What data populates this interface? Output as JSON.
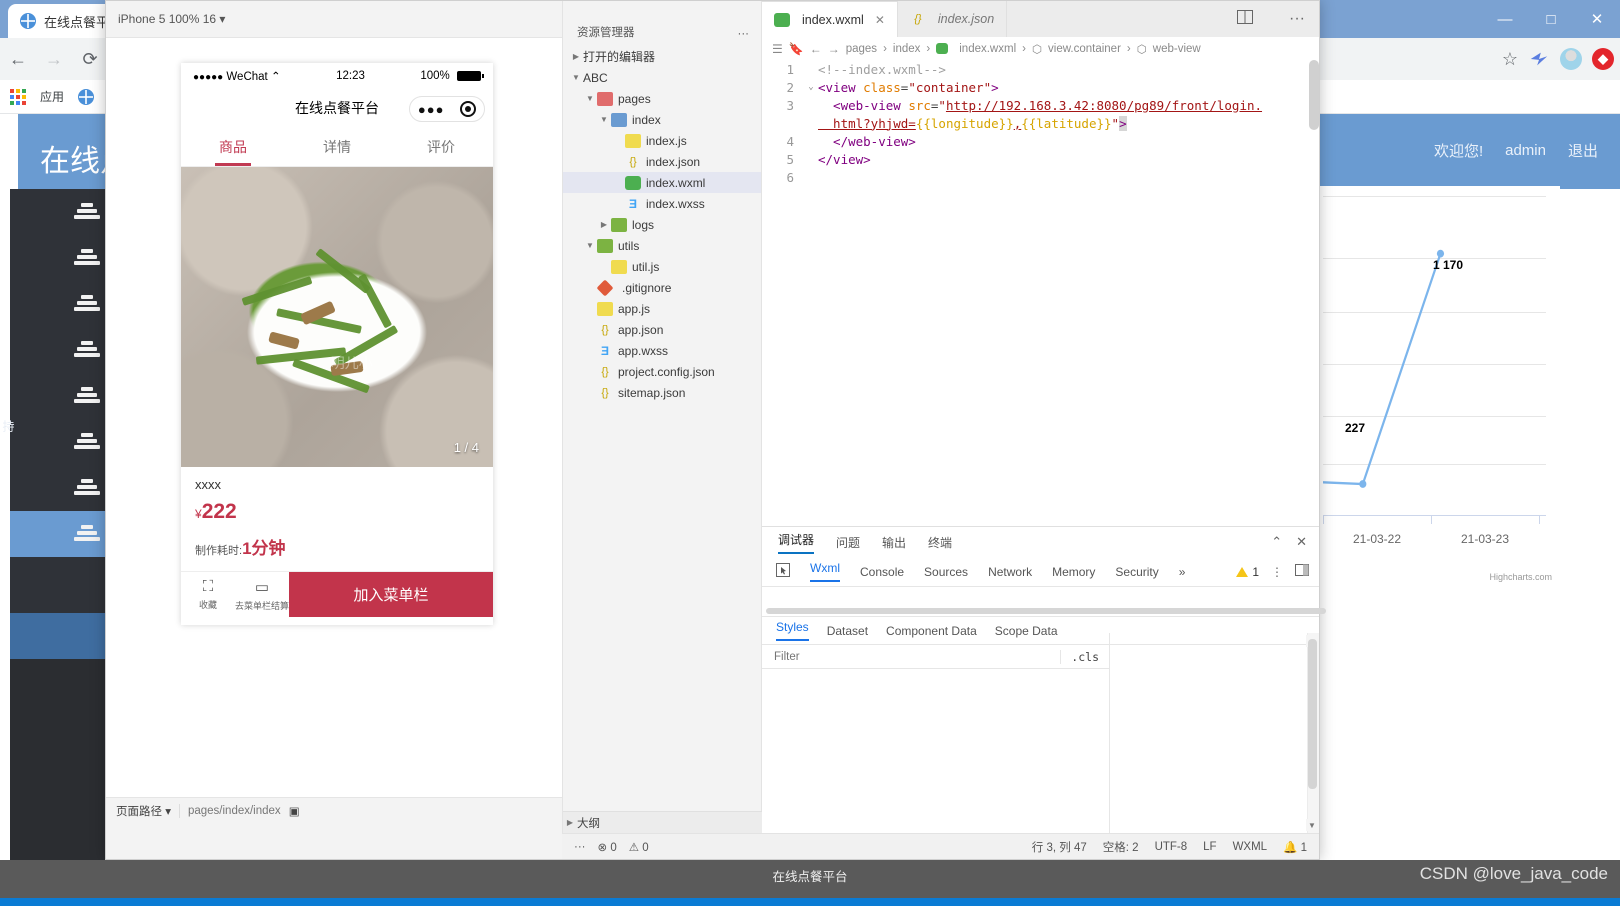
{
  "browser": {
    "tab_title": "在线点餐平",
    "window_controls": {
      "minimize": "—",
      "maximize": "□",
      "close": "✕"
    },
    "nav": {
      "back": "←",
      "forward": "→",
      "reload": "⟳"
    },
    "bookmarks": {
      "apps_label": "应用"
    },
    "right_icons": [
      "star-icon",
      "extension-icon",
      "avatar-icon",
      "opera-icon"
    ]
  },
  "app": {
    "title": "在线点餐平台",
    "welcome": "欢迎您!",
    "user": "admin",
    "logout": "退出",
    "sidebar_item_count": 8,
    "side_label": "持",
    "accent": "#6a9bd1"
  },
  "chart_data": {
    "type": "line",
    "title": "",
    "x": [
      "21-03-22",
      "21-03-23"
    ],
    "categories": [
      "21-03-22",
      "21-03-23"
    ],
    "series": [
      {
        "name": "",
        "values": [
          227,
          1170
        ]
      }
    ],
    "point_labels": [
      "227",
      "1 170"
    ],
    "xlabel": "",
    "ylabel": "",
    "ylim": [
      0,
      1400
    ],
    "grid": true,
    "legend": "none",
    "credits": "Highcharts.com",
    "line_color": "#7cb5ec"
  },
  "devtools": {
    "device_selector": "iPhone 5 100% 16",
    "toolbar_icons": [
      "phone-icon",
      "record-icon",
      "volume-icon",
      "clipboard-icon",
      "list-icon",
      "search-icon",
      "more-icon",
      "split-icon"
    ],
    "simulator": {
      "status": {
        "carrier": "WeChat",
        "signal_dots": "●●●●●",
        "time": "12:23",
        "battery": "100%"
      },
      "nav_title": "在线点餐平台",
      "tabs": [
        {
          "label": "商品",
          "active": true
        },
        {
          "label": "详情",
          "active": false
        },
        {
          "label": "评价",
          "active": false
        }
      ],
      "image_counter": "1 / 4",
      "image_watermark": "明儿小",
      "product": {
        "name": "xxxx",
        "currency": "¥",
        "price": "222",
        "time_label": "制作耗时:",
        "time_value": "1分钟"
      },
      "actions": [
        {
          "icon": "favorite-icon",
          "label": "收藏"
        },
        {
          "icon": "cart-icon",
          "label": "去菜单栏结算"
        }
      ],
      "primary_action": "加入菜单栏"
    },
    "footer": {
      "page_path_label": "页面路径",
      "page_path_value": "pages/index/index",
      "copy_icon": "copy-icon",
      "eye_icon": "eye-icon",
      "more_icon": "more-icon"
    },
    "explorer": {
      "title": "资源管理器",
      "more": "···",
      "open_editors": "打开的编辑器",
      "project": "ABC",
      "tree": [
        {
          "depth": 1,
          "label": "pages",
          "type": "folder-red",
          "caret": "▾"
        },
        {
          "depth": 2,
          "label": "index",
          "type": "folder-blue",
          "caret": "▾"
        },
        {
          "depth": 3,
          "label": "index.js",
          "type": "js",
          "caret": ""
        },
        {
          "depth": 3,
          "label": "index.json",
          "type": "json",
          "caret": ""
        },
        {
          "depth": 3,
          "label": "index.wxml",
          "type": "wxml",
          "caret": "",
          "selected": true
        },
        {
          "depth": 3,
          "label": "index.wxss",
          "type": "wxss",
          "caret": ""
        },
        {
          "depth": 2,
          "label": "logs",
          "type": "folder-green",
          "caret": "▸"
        },
        {
          "depth": 1,
          "label": "utils",
          "type": "folder-green",
          "caret": "▾"
        },
        {
          "depth": 2,
          "label": "util.js",
          "type": "js",
          "caret": ""
        },
        {
          "depth": 1,
          "label": ".gitignore",
          "type": "git",
          "caret": ""
        },
        {
          "depth": 1,
          "label": "app.js",
          "type": "js",
          "caret": ""
        },
        {
          "depth": 1,
          "label": "app.json",
          "type": "json",
          "caret": ""
        },
        {
          "depth": 1,
          "label": "app.wxss",
          "type": "wxss",
          "caret": ""
        },
        {
          "depth": 1,
          "label": "project.config.json",
          "type": "json",
          "caret": ""
        },
        {
          "depth": 1,
          "label": "sitemap.json",
          "type": "json",
          "caret": ""
        }
      ],
      "outline": "大纲",
      "status_errors": "0",
      "status_warnings": "0",
      "more_status": "···"
    },
    "editor": {
      "tabs": [
        {
          "label": "index.wxml",
          "active": true,
          "closable": true
        },
        {
          "label": "index.json",
          "active": false,
          "preview": true
        }
      ],
      "split_icon": "split-editor-icon",
      "more_icon": "more-icon",
      "breadcrumb": [
        "pages",
        "index",
        "index.wxml",
        "view.container",
        "web-view"
      ],
      "code_lines": [
        {
          "n": "1",
          "fold": "",
          "tokens": [
            {
              "t": "comment",
              "v": "<!--index.wxml-->"
            }
          ]
        },
        {
          "n": "2",
          "fold": "⌄",
          "tokens": [
            {
              "t": "tag",
              "v": "<view "
            },
            {
              "t": "attr",
              "v": "class"
            },
            {
              "t": "punct",
              "v": "="
            },
            {
              "t": "str",
              "v": "\"container\""
            },
            {
              "t": "tag",
              "v": ">"
            }
          ]
        },
        {
          "n": "3",
          "fold": "",
          "tokens": [
            {
              "t": "tag",
              "v": "  <web-view "
            },
            {
              "t": "attr",
              "v": "src"
            },
            {
              "t": "punct",
              "v": "="
            },
            {
              "t": "str",
              "v": "\""
            },
            {
              "t": "url",
              "v": "http://192.168.3.42:8080/pg89/front/login."
            }
          ]
        },
        {
          "n": "",
          "fold": "",
          "tokens": [
            {
              "t": "url",
              "v": "  html?yhjwd="
            },
            {
              "t": "mustache",
              "v": "{{longitude}}"
            },
            {
              "t": "url",
              "v": ","
            },
            {
              "t": "mustache",
              "v": "{{latitude}}"
            },
            {
              "t": "str",
              "v": "\""
            },
            {
              "t": "tag",
              "v": ">"
            }
          ]
        },
        {
          "n": "4",
          "fold": "",
          "tokens": [
            {
              "t": "tag",
              "v": "  </web-view>"
            }
          ]
        },
        {
          "n": "5",
          "fold": "",
          "tokens": [
            {
              "t": "tag",
              "v": "</view>"
            }
          ]
        },
        {
          "n": "6",
          "fold": "",
          "tokens": []
        }
      ]
    },
    "debug": {
      "panel_tabs": [
        {
          "label": "调试器",
          "active": true
        },
        {
          "label": "问题",
          "active": false
        },
        {
          "label": "输出",
          "active": false
        },
        {
          "label": "终端",
          "active": false
        }
      ],
      "collapse_icon": "chevron-up-icon",
      "close_icon": "close-icon",
      "devtool_tabs": [
        {
          "label": "Wxml",
          "active": true
        },
        {
          "label": "Console",
          "active": false
        },
        {
          "label": "Sources",
          "active": false
        },
        {
          "label": "Network",
          "active": false
        },
        {
          "label": "Memory",
          "active": false
        },
        {
          "label": "Security",
          "active": false
        }
      ],
      "overflow": "»",
      "warning_count": "1",
      "kebab_icon": "more-vertical-icon",
      "dock_icon": "dock-icon",
      "inspect_icon": "inspect-element-icon",
      "sub_tabs": [
        {
          "label": "Styles",
          "active": true
        },
        {
          "label": "Dataset",
          "active": false
        },
        {
          "label": "Component Data",
          "active": false
        },
        {
          "label": "Scope Data",
          "active": false
        }
      ],
      "filter_placeholder": "Filter",
      "cls_button": ".cls"
    },
    "status_bar": {
      "more": "···",
      "errors": "0",
      "warnings": "0",
      "cursor": "行 3, 列 47",
      "spaces": "空格: 2",
      "encoding": "UTF-8",
      "eol": "LF",
      "language": "WXML",
      "bell_icon": "bell-icon",
      "bell_count": "1"
    }
  },
  "taskbar": {
    "app_label": "在线点餐平台",
    "watermark": "CSDN @love_java_code"
  }
}
